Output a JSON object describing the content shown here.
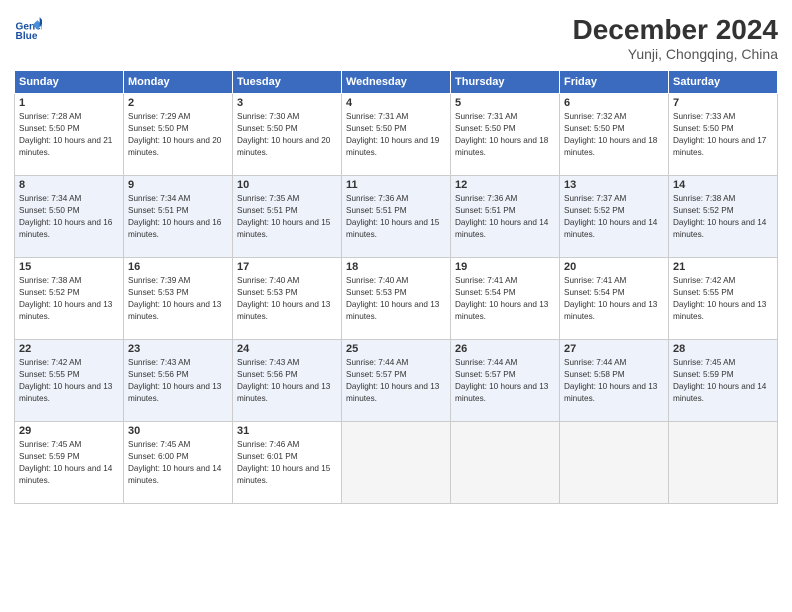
{
  "header": {
    "logo_line1": "General",
    "logo_line2": "Blue",
    "month": "December 2024",
    "location": "Yunji, Chongqing, China"
  },
  "weekdays": [
    "Sunday",
    "Monday",
    "Tuesday",
    "Wednesday",
    "Thursday",
    "Friday",
    "Saturday"
  ],
  "weeks": [
    [
      {
        "day": "1",
        "sunrise": "Sunrise: 7:28 AM",
        "sunset": "Sunset: 5:50 PM",
        "daylight": "Daylight: 10 hours and 21 minutes."
      },
      {
        "day": "2",
        "sunrise": "Sunrise: 7:29 AM",
        "sunset": "Sunset: 5:50 PM",
        "daylight": "Daylight: 10 hours and 20 minutes."
      },
      {
        "day": "3",
        "sunrise": "Sunrise: 7:30 AM",
        "sunset": "Sunset: 5:50 PM",
        "daylight": "Daylight: 10 hours and 20 minutes."
      },
      {
        "day": "4",
        "sunrise": "Sunrise: 7:31 AM",
        "sunset": "Sunset: 5:50 PM",
        "daylight": "Daylight: 10 hours and 19 minutes."
      },
      {
        "day": "5",
        "sunrise": "Sunrise: 7:31 AM",
        "sunset": "Sunset: 5:50 PM",
        "daylight": "Daylight: 10 hours and 18 minutes."
      },
      {
        "day": "6",
        "sunrise": "Sunrise: 7:32 AM",
        "sunset": "Sunset: 5:50 PM",
        "daylight": "Daylight: 10 hours and 18 minutes."
      },
      {
        "day": "7",
        "sunrise": "Sunrise: 7:33 AM",
        "sunset": "Sunset: 5:50 PM",
        "daylight": "Daylight: 10 hours and 17 minutes."
      }
    ],
    [
      {
        "day": "8",
        "sunrise": "Sunrise: 7:34 AM",
        "sunset": "Sunset: 5:50 PM",
        "daylight": "Daylight: 10 hours and 16 minutes."
      },
      {
        "day": "9",
        "sunrise": "Sunrise: 7:34 AM",
        "sunset": "Sunset: 5:51 PM",
        "daylight": "Daylight: 10 hours and 16 minutes."
      },
      {
        "day": "10",
        "sunrise": "Sunrise: 7:35 AM",
        "sunset": "Sunset: 5:51 PM",
        "daylight": "Daylight: 10 hours and 15 minutes."
      },
      {
        "day": "11",
        "sunrise": "Sunrise: 7:36 AM",
        "sunset": "Sunset: 5:51 PM",
        "daylight": "Daylight: 10 hours and 15 minutes."
      },
      {
        "day": "12",
        "sunrise": "Sunrise: 7:36 AM",
        "sunset": "Sunset: 5:51 PM",
        "daylight": "Daylight: 10 hours and 14 minutes."
      },
      {
        "day": "13",
        "sunrise": "Sunrise: 7:37 AM",
        "sunset": "Sunset: 5:52 PM",
        "daylight": "Daylight: 10 hours and 14 minutes."
      },
      {
        "day": "14",
        "sunrise": "Sunrise: 7:38 AM",
        "sunset": "Sunset: 5:52 PM",
        "daylight": "Daylight: 10 hours and 14 minutes."
      }
    ],
    [
      {
        "day": "15",
        "sunrise": "Sunrise: 7:38 AM",
        "sunset": "Sunset: 5:52 PM",
        "daylight": "Daylight: 10 hours and 13 minutes."
      },
      {
        "day": "16",
        "sunrise": "Sunrise: 7:39 AM",
        "sunset": "Sunset: 5:53 PM",
        "daylight": "Daylight: 10 hours and 13 minutes."
      },
      {
        "day": "17",
        "sunrise": "Sunrise: 7:40 AM",
        "sunset": "Sunset: 5:53 PM",
        "daylight": "Daylight: 10 hours and 13 minutes."
      },
      {
        "day": "18",
        "sunrise": "Sunrise: 7:40 AM",
        "sunset": "Sunset: 5:53 PM",
        "daylight": "Daylight: 10 hours and 13 minutes."
      },
      {
        "day": "19",
        "sunrise": "Sunrise: 7:41 AM",
        "sunset": "Sunset: 5:54 PM",
        "daylight": "Daylight: 10 hours and 13 minutes."
      },
      {
        "day": "20",
        "sunrise": "Sunrise: 7:41 AM",
        "sunset": "Sunset: 5:54 PM",
        "daylight": "Daylight: 10 hours and 13 minutes."
      },
      {
        "day": "21",
        "sunrise": "Sunrise: 7:42 AM",
        "sunset": "Sunset: 5:55 PM",
        "daylight": "Daylight: 10 hours and 13 minutes."
      }
    ],
    [
      {
        "day": "22",
        "sunrise": "Sunrise: 7:42 AM",
        "sunset": "Sunset: 5:55 PM",
        "daylight": "Daylight: 10 hours and 13 minutes."
      },
      {
        "day": "23",
        "sunrise": "Sunrise: 7:43 AM",
        "sunset": "Sunset: 5:56 PM",
        "daylight": "Daylight: 10 hours and 13 minutes."
      },
      {
        "day": "24",
        "sunrise": "Sunrise: 7:43 AM",
        "sunset": "Sunset: 5:56 PM",
        "daylight": "Daylight: 10 hours and 13 minutes."
      },
      {
        "day": "25",
        "sunrise": "Sunrise: 7:44 AM",
        "sunset": "Sunset: 5:57 PM",
        "daylight": "Daylight: 10 hours and 13 minutes."
      },
      {
        "day": "26",
        "sunrise": "Sunrise: 7:44 AM",
        "sunset": "Sunset: 5:57 PM",
        "daylight": "Daylight: 10 hours and 13 minutes."
      },
      {
        "day": "27",
        "sunrise": "Sunrise: 7:44 AM",
        "sunset": "Sunset: 5:58 PM",
        "daylight": "Daylight: 10 hours and 13 minutes."
      },
      {
        "day": "28",
        "sunrise": "Sunrise: 7:45 AM",
        "sunset": "Sunset: 5:59 PM",
        "daylight": "Daylight: 10 hours and 14 minutes."
      }
    ],
    [
      {
        "day": "29",
        "sunrise": "Sunrise: 7:45 AM",
        "sunset": "Sunset: 5:59 PM",
        "daylight": "Daylight: 10 hours and 14 minutes."
      },
      {
        "day": "30",
        "sunrise": "Sunrise: 7:45 AM",
        "sunset": "Sunset: 6:00 PM",
        "daylight": "Daylight: 10 hours and 14 minutes."
      },
      {
        "day": "31",
        "sunrise": "Sunrise: 7:46 AM",
        "sunset": "Sunset: 6:01 PM",
        "daylight": "Daylight: 10 hours and 15 minutes."
      },
      null,
      null,
      null,
      null
    ]
  ]
}
